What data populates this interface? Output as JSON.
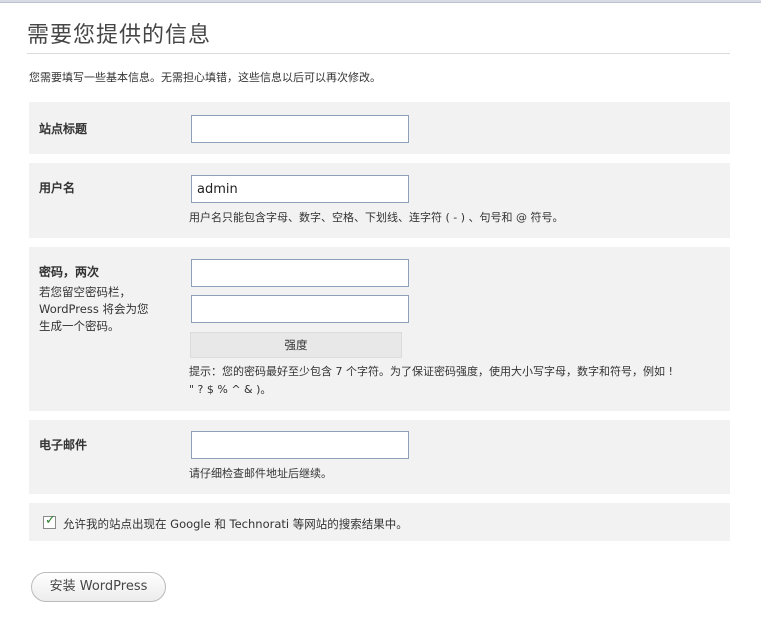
{
  "page": {
    "title": "需要您提供的信息",
    "intro": "您需要填写一些基本信息。无需担心填错，这些信息以后可以再次修改。"
  },
  "site_title": {
    "label": "站点标题",
    "value": ""
  },
  "username": {
    "label": "用户名",
    "value": "admin",
    "help": "用户名只能包含字母、数字、空格、下划线、连字符 ( - ) 、句号和 @ 符号。"
  },
  "password": {
    "label": "密码，两次",
    "sublabel_line1": "若您留空密码栏，",
    "sublabel_line2": "WordPress 将会为您",
    "sublabel_line3": "生成一个密码。",
    "value1": "",
    "value2": "",
    "strength_label": "强度",
    "hint_line1": "提示：您的密码最好至少包含 7 个字符。为了保证密码强度，使用大小写字母，数字和符号，例如 !",
    "hint_line2": "\" ? $ % ^ & )。"
  },
  "email": {
    "label": "电子邮件",
    "value": "",
    "help": "请仔细检查邮件地址后继续。"
  },
  "privacy": {
    "checked": true,
    "label": "允许我的站点出现在 Google 和 Technorati 等网站的搜索结果中。"
  },
  "install_button": {
    "label": "安装 WordPress"
  },
  "colors": {
    "row_background": "#f2f2f2",
    "field_border": "#8ea0b7",
    "check_color": "#2a7d2a"
  }
}
